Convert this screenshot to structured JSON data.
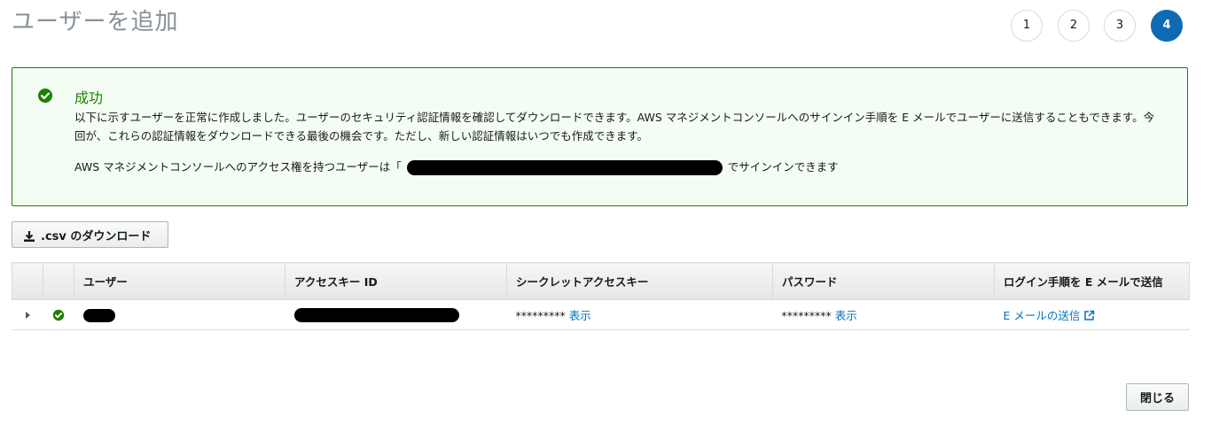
{
  "page": {
    "title": "ユーザーを追加"
  },
  "steps": [
    {
      "label": "1",
      "active": false
    },
    {
      "label": "2",
      "active": false
    },
    {
      "label": "3",
      "active": false
    },
    {
      "label": "4",
      "active": true
    }
  ],
  "success": {
    "title": "成功",
    "message": "以下に示すユーザーを正常に作成しました。ユーザーのセキュリティ認証情報を確認してダウンロードできます。AWS マネジメントコンソールへのサインイン手順を E メールでユーザーに送信することもできます。今回が、これらの認証情報をダウンロードできる最後の機会です。ただし、新しい認証情報はいつでも作成できます。",
    "signin_prefix": "AWS マネジメントコンソールへのアクセス権を持つユーザーは「",
    "signin_suffix": "でサインインできます"
  },
  "toolbar": {
    "csv_label": ".csv のダウンロード"
  },
  "table": {
    "headers": {
      "user": "ユーザー",
      "access_key": "アクセスキー ID",
      "secret": "シークレットアクセスキー",
      "password": "パスワード",
      "login": "ログイン手順を E メールで送信"
    },
    "row": {
      "secret_mask": "*********",
      "secret_show": "表示",
      "password_mask": "*********",
      "password_show": "表示",
      "send_email": "E メールの送信"
    }
  },
  "footer": {
    "close_label": "閉じる"
  },
  "colors": {
    "accent": "#0f6ab4",
    "success": "#1d8102",
    "link": "#0073bb"
  },
  "icons": [
    "check-circle-icon",
    "download-icon",
    "caret-right-icon",
    "external-link-icon"
  ]
}
